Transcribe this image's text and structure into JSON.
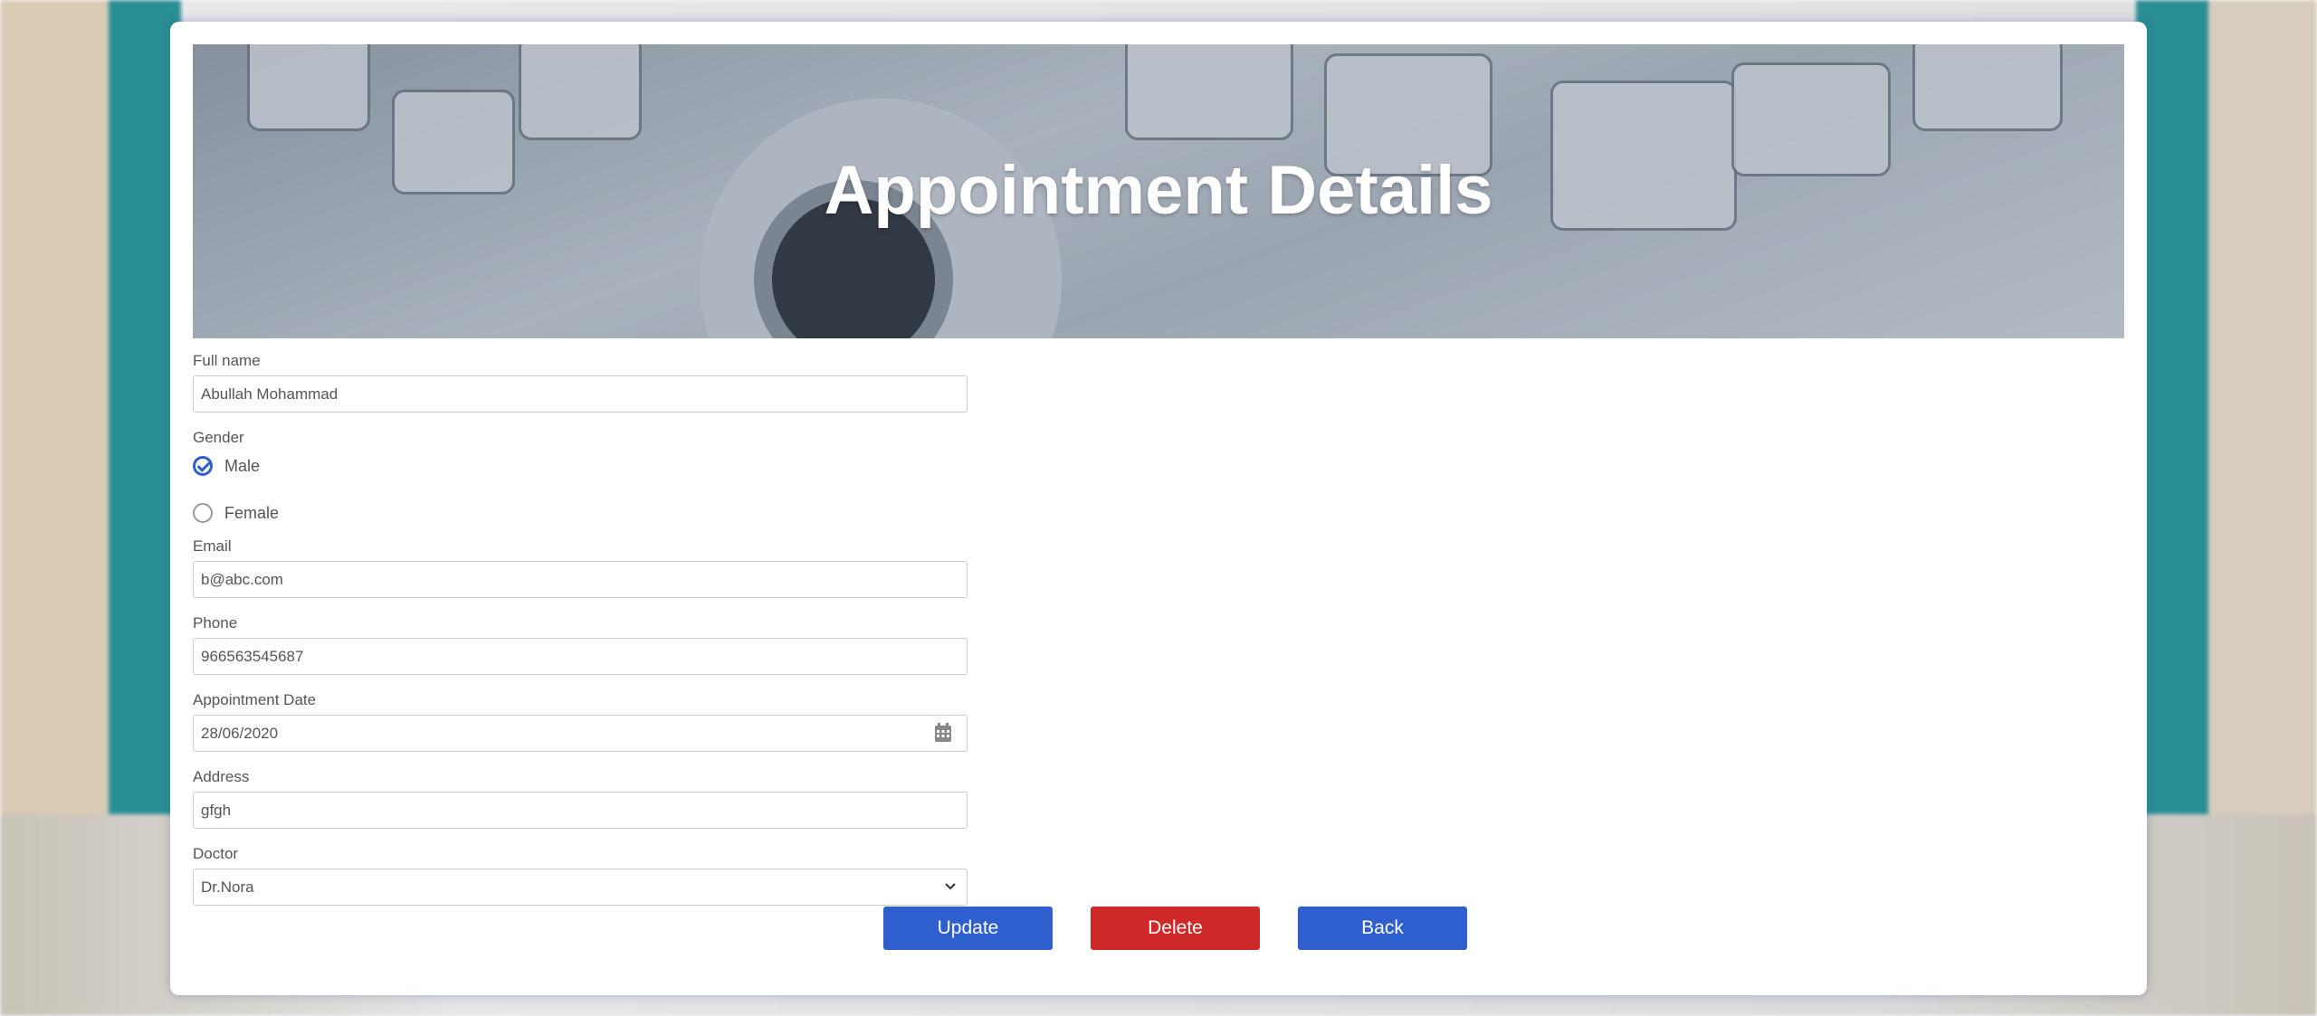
{
  "banner": {
    "title": "Appointment Details"
  },
  "form": {
    "full_name": {
      "label": "Full name",
      "value": "Abullah Mohammad"
    },
    "gender": {
      "label": "Gender",
      "options": [
        {
          "label": "Male",
          "checked": true
        },
        {
          "label": "Female",
          "checked": false
        }
      ]
    },
    "email": {
      "label": "Email",
      "value": "b@abc.com"
    },
    "phone": {
      "label": "Phone",
      "value": "966563545687"
    },
    "appointment_date": {
      "label": "Appointment Date",
      "value": "28/06/2020"
    },
    "address": {
      "label": "Address",
      "value": "gfgh"
    },
    "doctor": {
      "label": "Doctor",
      "selected": "Dr.Nora"
    }
  },
  "actions": {
    "update_label": "Update",
    "delete_label": "Delete",
    "back_label": "Back"
  },
  "colors": {
    "primary": "#2f5fcf",
    "danger": "#cf2828"
  },
  "icons": [
    "check-icon",
    "calendar-icon",
    "chevron-down-icon"
  ]
}
